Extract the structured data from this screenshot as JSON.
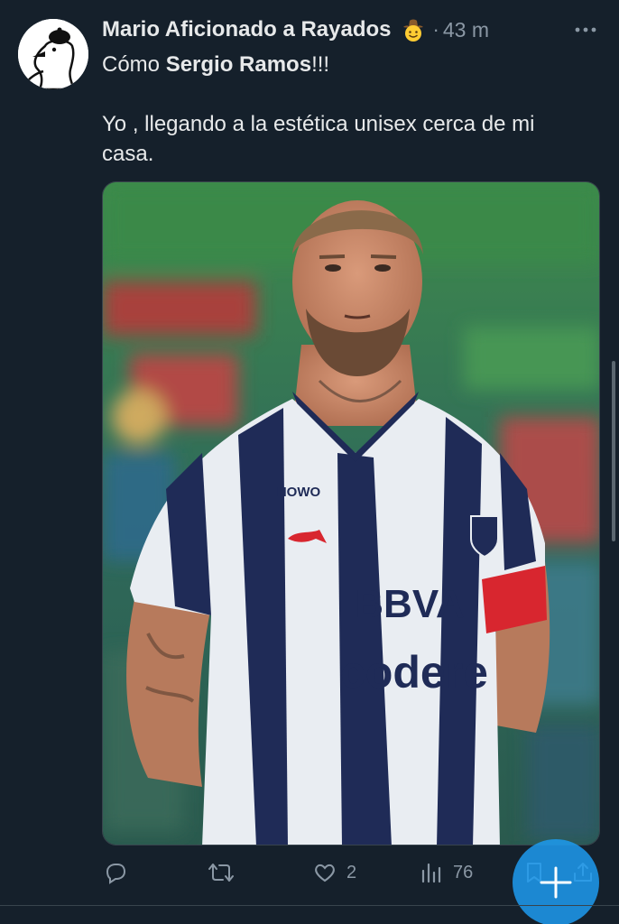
{
  "tweet": {
    "display_name": "Mario Aficionado a Rayados",
    "name_emoji": "cowboy-face-emoji",
    "separator": "·",
    "timestamp": "43 m",
    "text_line1_prefix": "Cómo ",
    "text_line1_bold": "Sergio Ramos",
    "text_line1_suffix": "!!!",
    "text_body": "Yo , llegando a la estética unisex cerca de mi casa.",
    "media": {
      "jersey_sponsor_main": "BBVA",
      "jersey_sponsor_secondary": "codere",
      "jersey_sleeve_brand": "HOWO",
      "colors": {
        "stripe_navy": "#1f2b57",
        "stripe_white": "#e9edf2",
        "armband": "#d8262f",
        "stand_green": "#3f8a4c",
        "stand_red": "#b53a3a"
      }
    }
  },
  "actions": {
    "reply_icon": "reply-icon",
    "retweet_icon": "retweet-icon",
    "like_icon": "heart-icon",
    "like_count": "2",
    "views_icon": "views-icon",
    "views_count": "76",
    "bookmark_icon": "bookmark-icon",
    "share_icon": "share-icon"
  },
  "compose_button_icon": "plus-icon",
  "colors": {
    "background": "#15202b",
    "text_primary": "#e7e9ea",
    "text_secondary": "#8b98a5",
    "accent": "#1d9bf0"
  }
}
